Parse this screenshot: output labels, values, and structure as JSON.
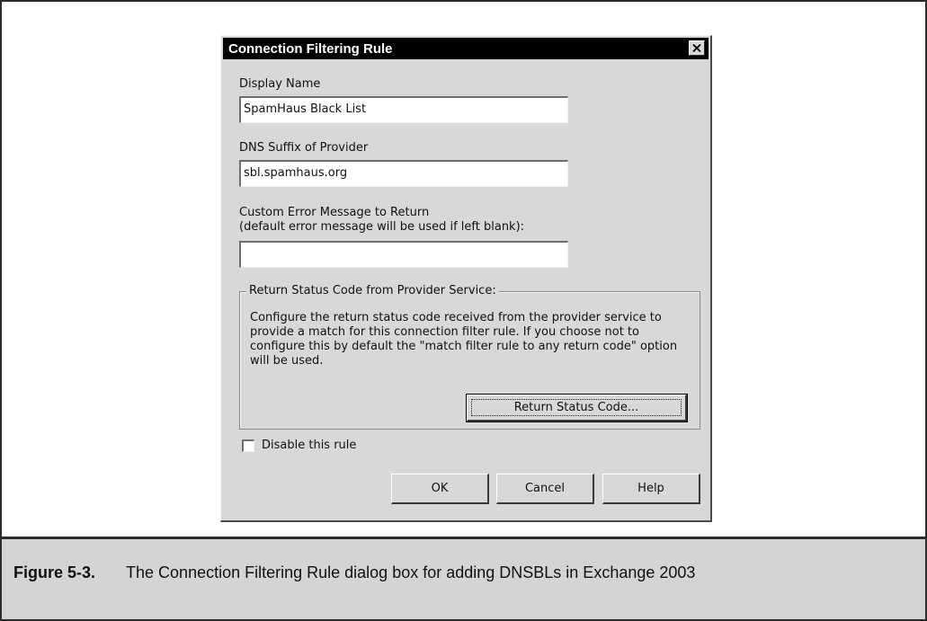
{
  "dialog": {
    "title": "Connection Filtering Rule",
    "display_name": {
      "label": "Display Name",
      "value": "SpamHaus Black List"
    },
    "dns_suffix": {
      "label": "DNS Suffix of Provider",
      "value": "sbl.spamhaus.org"
    },
    "custom_error": {
      "label_line1": "Custom Error Message to Return",
      "label_line2": "(default error message will be used if left blank):",
      "value": ""
    },
    "status_group": {
      "legend": "Return Status Code from Provider Service:",
      "description": "Configure the return status code received from the provider service to provide a match for this connection filter rule. If you choose not to configure this by default the \"match filter rule to any return code\" option will be used.",
      "button_label": "Return Status Code..."
    },
    "disable_rule": {
      "label": "Disable this rule",
      "checked": false
    },
    "buttons": {
      "ok": "OK",
      "cancel": "Cancel",
      "help": "Help"
    }
  },
  "caption": {
    "label": "Figure 5-3.",
    "text": "The Connection Filtering Rule dialog box for adding DNSBLs in Exchange 2003"
  }
}
